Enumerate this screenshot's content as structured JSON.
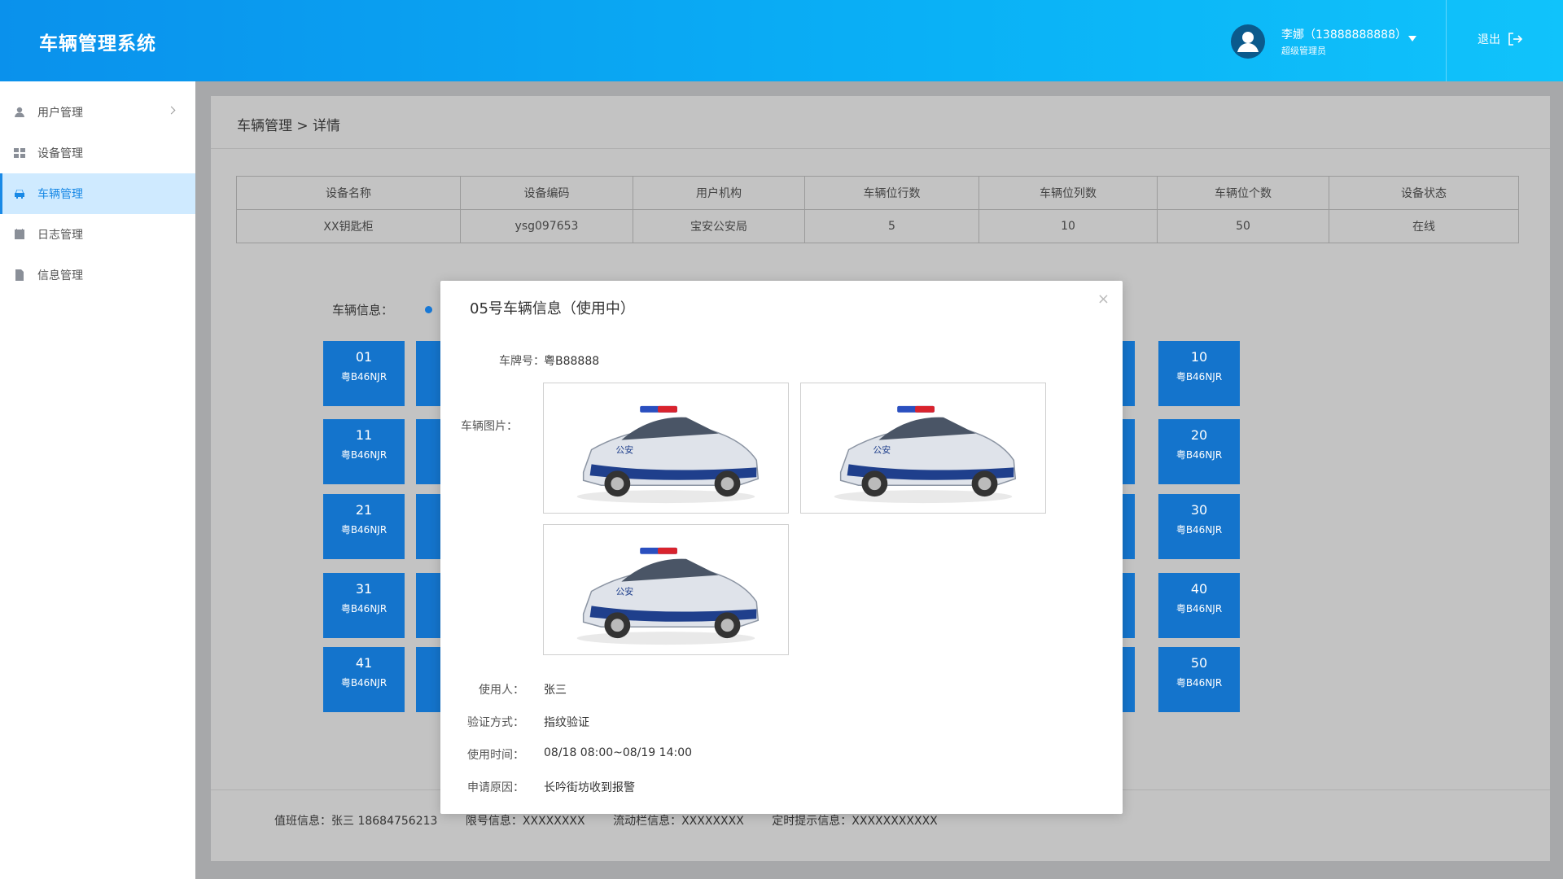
{
  "header": {
    "app_title": "车辆管理系统",
    "user_name": "李娜（13888888888）",
    "user_role": "超级管理员",
    "logout_label": "退出"
  },
  "sidebar": {
    "items": [
      {
        "label": "用户管理",
        "icon": "user-icon",
        "has_submenu": true
      },
      {
        "label": "设备管理",
        "icon": "grid-icon"
      },
      {
        "label": "车辆管理",
        "icon": "car-icon",
        "active": true
      },
      {
        "label": "日志管理",
        "icon": "log-icon"
      },
      {
        "label": "信息管理",
        "icon": "document-icon"
      }
    ]
  },
  "main": {
    "breadcrumb": "车辆管理 > 详情",
    "device_table": {
      "headers": [
        "设备名称",
        "设备编码",
        "用户机构",
        "车辆位行数",
        "车辆位列数",
        "车辆位个数",
        "设备状态"
      ],
      "row": [
        "XX钥匙柜",
        "ysg097653",
        "宝安公安局",
        "5",
        "10",
        "50",
        "在线"
      ]
    },
    "vehicle_label": "车辆信息：",
    "grid_tiles": [
      {
        "num": "01",
        "plate": "粤B46NJR"
      },
      {
        "num": "10",
        "plate": "粤B46NJR"
      },
      {
        "num": "11",
        "plate": "粤B46NJR"
      },
      {
        "num": "20",
        "plate": "粤B46NJR"
      },
      {
        "num": "21",
        "plate": "粤B46NJR"
      },
      {
        "num": "30",
        "plate": "粤B46NJR"
      },
      {
        "num": "31",
        "plate": "粤B46NJR"
      },
      {
        "num": "40",
        "plate": "粤B46NJR"
      },
      {
        "num": "41",
        "plate": "粤B46NJR"
      },
      {
        "num": "50",
        "plate": "粤B46NJR"
      }
    ],
    "footer": {
      "duty": "值班信息：张三 18684756213",
      "restriction": "限号信息：XXXXXXXX",
      "ticker": "流动栏信息：XXXXXXXX",
      "reminder": "定时提示信息：XXXXXXXXXXX"
    }
  },
  "modal": {
    "title": "05号车辆信息（使用中）",
    "close_icon": "×",
    "plate_label": "车牌号：",
    "plate_value": "粤B88888",
    "photos_label": "车辆图片：",
    "user_label": "使用人：",
    "user_value": "张三",
    "verify_label": "验证方式：",
    "verify_value": "指纹验证",
    "time_label": "使用时间：",
    "time_value": "08/18 08:00~08/19 14:00",
    "reason_label": "申请原因：",
    "reason_value": "长吟街坊收到报警"
  },
  "colors": {
    "header_start": "#0a91ec",
    "header_end": "#10c3fb",
    "accent": "#1989e6",
    "tile": "#1474cc"
  }
}
